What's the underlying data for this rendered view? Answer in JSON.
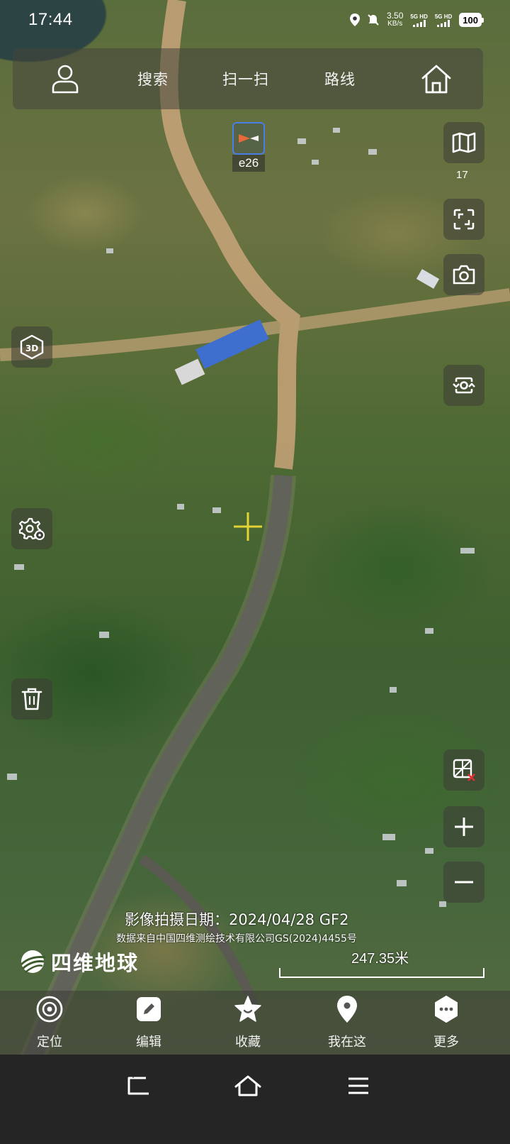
{
  "status_bar": {
    "time": "17:44",
    "net_speed_value": "3.50",
    "net_speed_unit": "KB/s",
    "sim1": "5G HD",
    "sim2": "5G HD",
    "battery": "100"
  },
  "top_panel": {
    "search_label": "搜索",
    "scan_label": "扫一扫",
    "route_label": "路线"
  },
  "marker": {
    "label": "e26"
  },
  "right_controls": {
    "map_level": "17"
  },
  "attribution": {
    "capture_date": "影像拍摄日期：2024/04/28 GF2",
    "data_source": "数据来自中国四维测绘技术有限公司GS(2024)4455号",
    "brand": "四维地球",
    "scale": "247.35米"
  },
  "bottom_bar": {
    "locate_label": "定位",
    "edit_label": "编辑",
    "favorite_label": "收藏",
    "here_label": "我在这",
    "more_label": "更多"
  },
  "colors": {
    "marker_border": "#4a7de6",
    "crosshair": "#e3d335",
    "delete_x": "#e23030"
  },
  "icons": [
    "user-icon",
    "home-icon",
    "map-layers-icon",
    "fullscreen-icon",
    "camera-icon",
    "3d-icon",
    "screen-rotate-icon",
    "settings-location-icon",
    "trash-icon",
    "grid-off-icon",
    "zoom-in-icon",
    "zoom-out-icon",
    "locate-icon",
    "edit-icon",
    "star-icon",
    "pin-icon",
    "more-icon",
    "back-icon",
    "home-nav-icon",
    "menu-icon"
  ]
}
